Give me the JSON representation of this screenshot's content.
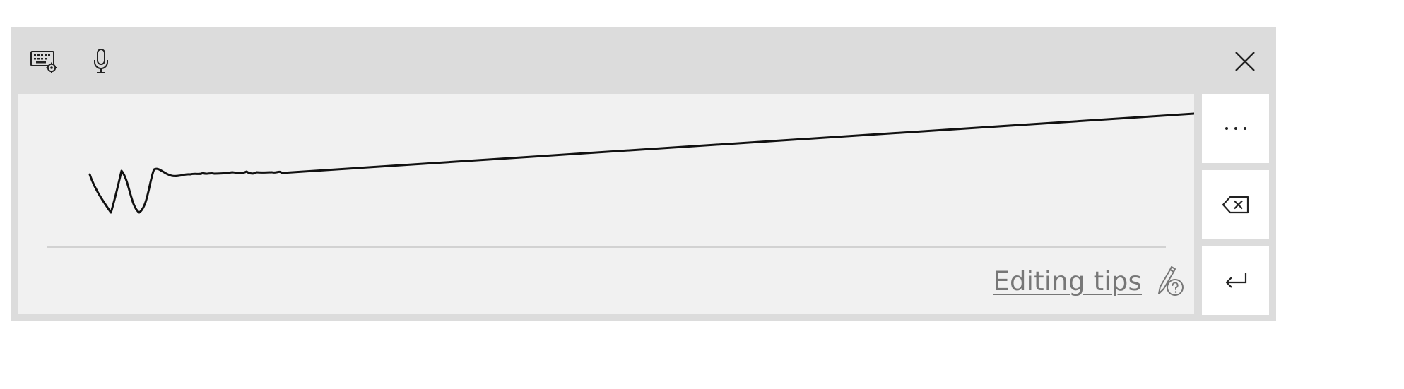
{
  "toolbar": {
    "keyboard_settings_icon": "keyboard-settings-icon",
    "microphone_icon": "microphone-icon",
    "close_icon": "close-icon"
  },
  "handwriting": {
    "editing_tips_label": "Editing tips",
    "editing_tips_icon": "pen-help-icon"
  },
  "side_buttons": {
    "more_icon": "more-icon",
    "backspace_icon": "backspace-icon",
    "enter_icon": "enter-icon"
  },
  "colors": {
    "panel_bg": "#dcdcdc",
    "canvas_bg": "#f1f1f1",
    "ink": "#111111",
    "tips_text": "#777777"
  }
}
